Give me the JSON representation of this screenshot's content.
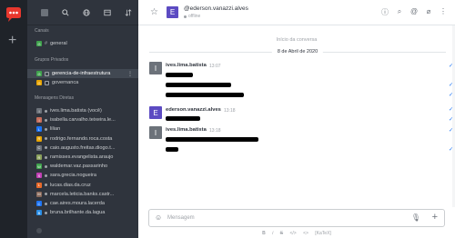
{
  "sidebar": {
    "sections": {
      "channels": "Canais",
      "private_groups": "Grupos Privados",
      "direct": "Mensagens Diretas"
    },
    "channels": [
      {
        "label": "general",
        "color": "#3fa34d",
        "letter": "G"
      }
    ],
    "groups": [
      {
        "label": "gerencia-de-infraestrutura",
        "color": "#3fa34d",
        "letter": "G",
        "active": true
      },
      {
        "label": "governanca",
        "color": "#e8a400",
        "letter": "G",
        "active": false
      }
    ],
    "dms": [
      {
        "label": "ives.lima.batista (você)",
        "color": "#6c727a",
        "letter": "I"
      },
      {
        "label": "isabella.carvalho.teixeira.le...",
        "color": "#c76e5b",
        "letter": "I"
      },
      {
        "label": "lilian",
        "color": "#1d74f5",
        "letter": "L"
      },
      {
        "label": "rodrigo.fernando.roca.costa",
        "color": "#e8a400",
        "letter": "R"
      },
      {
        "label": "caio.augusto.freitas.diogo.t...",
        "color": "#6c727a",
        "letter": "C"
      },
      {
        "label": "ramisses.evangelista.araujo",
        "color": "#8aa05b",
        "letter": "R"
      },
      {
        "label": "waldemar.vaz.passarinho",
        "color": "#3fa34d",
        "letter": "W"
      },
      {
        "label": "sara.grecia.nogueira",
        "color": "#c13fb4",
        "letter": "S"
      },
      {
        "label": "lucas.dias.da.cruz",
        "color": "#e86a2a",
        "letter": "L"
      },
      {
        "label": "marcela.leticia.banks.castr...",
        "color": "#8a6a5b",
        "letter": "M"
      },
      {
        "label": "cae.aires.moura.lacerda",
        "color": "#1d74f5",
        "letter": "C"
      },
      {
        "label": "bruna.brilhante.da.lagua",
        "color": "#2a8fe8",
        "letter": "B"
      }
    ]
  },
  "header": {
    "name": "@ederson.vanazzi.alves",
    "status": "offline",
    "avatar_letter": "E",
    "avatar_color": "#5c4bc2"
  },
  "chat": {
    "start_label": "Início da conversa",
    "date_label": "8 de Abril de 2020",
    "messages": [
      {
        "author": "ives.lima.batista",
        "time": "13:07",
        "letter": "I",
        "color": "#6c727a"
      },
      {
        "author": "ederson.vanazzi.alves",
        "time": "13:18",
        "letter": "E",
        "color": "#5c4bc2"
      },
      {
        "author": "ives.lima.batista",
        "time": "13:18",
        "letter": "I",
        "color": "#6c727a"
      }
    ]
  },
  "composer": {
    "placeholder": "Mensagem"
  },
  "format_bar": {
    "bold": "B",
    "italic": "i",
    "strike": "S",
    "code": "</>",
    "block": "<>",
    "katex": "[KaTeX]"
  }
}
